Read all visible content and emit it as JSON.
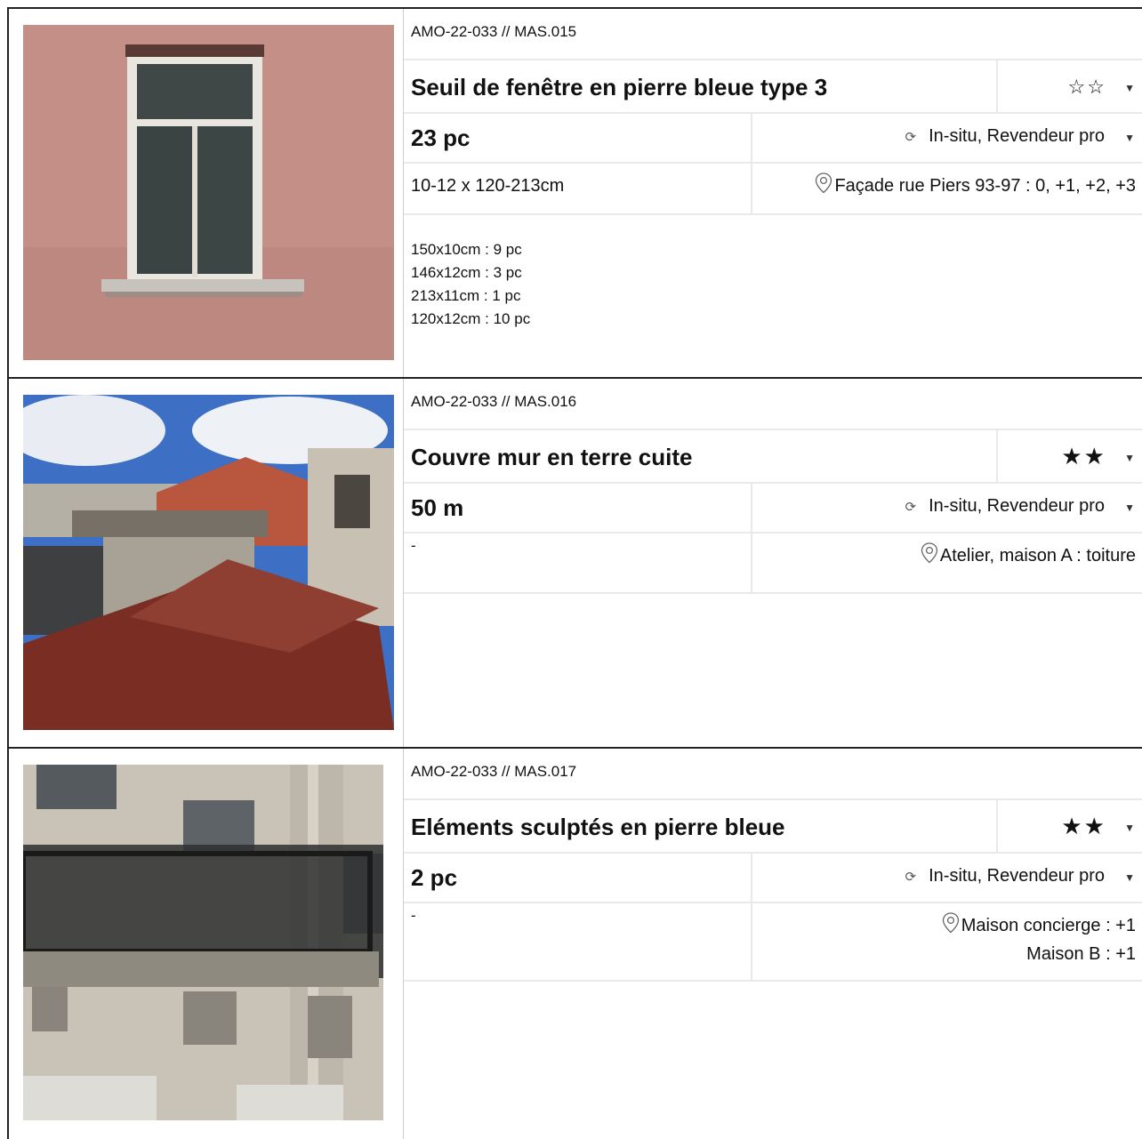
{
  "items": [
    {
      "code": "AMO-22-033 // MAS.015",
      "title": "Seuil de fenêtre en pierre bleue type 3",
      "rating": "☆☆",
      "quantity": "23 pc",
      "availability": "In-situ, Revendeur pro",
      "dimensions": "10-12 x 120-213cm",
      "location": [
        "Façade rue Piers 93-97 : 0, +1, +2, +3"
      ],
      "variants": [
        "150x10cm : 9 pc",
        "146x12cm : 3 pc",
        "213x11cm : 1 pc",
        "120x12cm : 10 pc"
      ]
    },
    {
      "code": "AMO-22-033 // MAS.016",
      "title": "Couvre mur en terre cuite",
      "rating": "★★",
      "quantity": "50 m",
      "availability": "In-situ, Revendeur pro",
      "dimensions": "-",
      "location": [
        "Atelier, maison A : toiture"
      ],
      "variants": []
    },
    {
      "code": "AMO-22-033 // MAS.017",
      "title": "Eléments sculptés en pierre bleue",
      "rating": "★★",
      "quantity": "2 pc",
      "availability": "In-situ, Revendeur pro",
      "dimensions": "-",
      "location": [
        "Maison concierge : +1",
        "Maison B : +1"
      ],
      "variants": []
    }
  ],
  "icons": {
    "refresh": "refresh-icon",
    "location": "location-pin-icon",
    "dropdown": "caret-down-icon"
  }
}
